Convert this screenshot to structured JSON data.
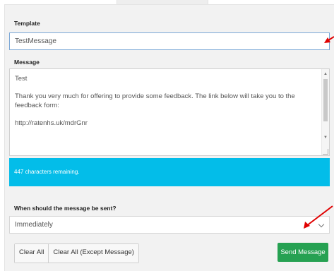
{
  "template": {
    "label": "Template",
    "value": "TestMessage"
  },
  "message": {
    "label": "Message",
    "lines": [
      "Test",
      "Thank you very much for offering to provide some feedback. The link below will take you to the feedback form:",
      "http://ratenhs.uk/mdrGnr"
    ],
    "remaining": "447 characters remaining."
  },
  "schedule": {
    "label": "When should the message be sent?",
    "value": "Immediately"
  },
  "buttons": {
    "clear_all": "Clear All",
    "clear_all_except": "Clear All (Except Message)",
    "send": "Send Message"
  },
  "colors": {
    "info_bar": "#03bde9",
    "send_button": "#26a152",
    "annotation_arrow": "#e00000"
  }
}
